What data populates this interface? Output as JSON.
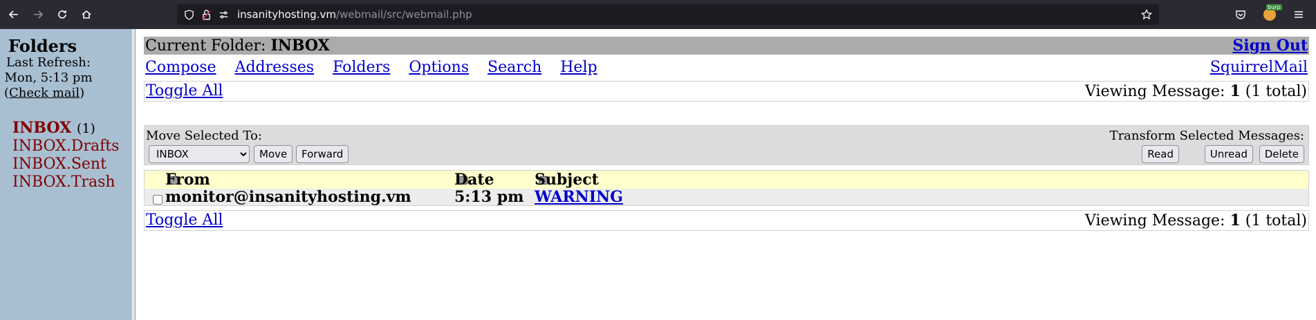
{
  "browser": {
    "url_host": "insanityhosting.vm",
    "url_path": "/webmail/src/webmail.php",
    "ext_label": "burp"
  },
  "sidebar": {
    "title": "Folders",
    "last_refresh_label": "Last Refresh:",
    "last_refresh_time": "Mon, 5:13 pm",
    "check_mail_open": "(",
    "check_mail": "Check mail",
    "check_mail_close": ")",
    "folders": [
      {
        "name": "INBOX",
        "count": "(1)",
        "active": true
      },
      {
        "name": "INBOX.Drafts",
        "count": ""
      },
      {
        "name": "INBOX.Sent",
        "count": ""
      },
      {
        "name": "INBOX.Trash",
        "count": ""
      }
    ]
  },
  "header": {
    "current_folder_label": "Current Folder: ",
    "current_folder": "INBOX",
    "sign_out": "Sign Out"
  },
  "menu": {
    "compose": "Compose",
    "addresses": "Addresses",
    "folders": "Folders",
    "options": "Options",
    "search": "Search",
    "help": "Help",
    "brand": "SquirrelMail"
  },
  "paging": {
    "toggle_all": "Toggle All",
    "viewing_prefix": "Viewing Message: ",
    "viewing_number": "1",
    "viewing_suffix": " (1 total)"
  },
  "actions": {
    "move_label": "Move Selected To:",
    "transform_label": "Transform Selected Messages:",
    "folder_selected": "INBOX",
    "move": "Move",
    "forward": "Forward",
    "read": "Read",
    "unread": "Unread",
    "delete": "Delete"
  },
  "messages": {
    "columns": {
      "from": "From",
      "date": "Date",
      "subject": "Subject"
    },
    "rows": [
      {
        "from": "monitor@insanityhosting.vm",
        "date": "5:13 pm",
        "subject": "WARNING"
      }
    ]
  }
}
